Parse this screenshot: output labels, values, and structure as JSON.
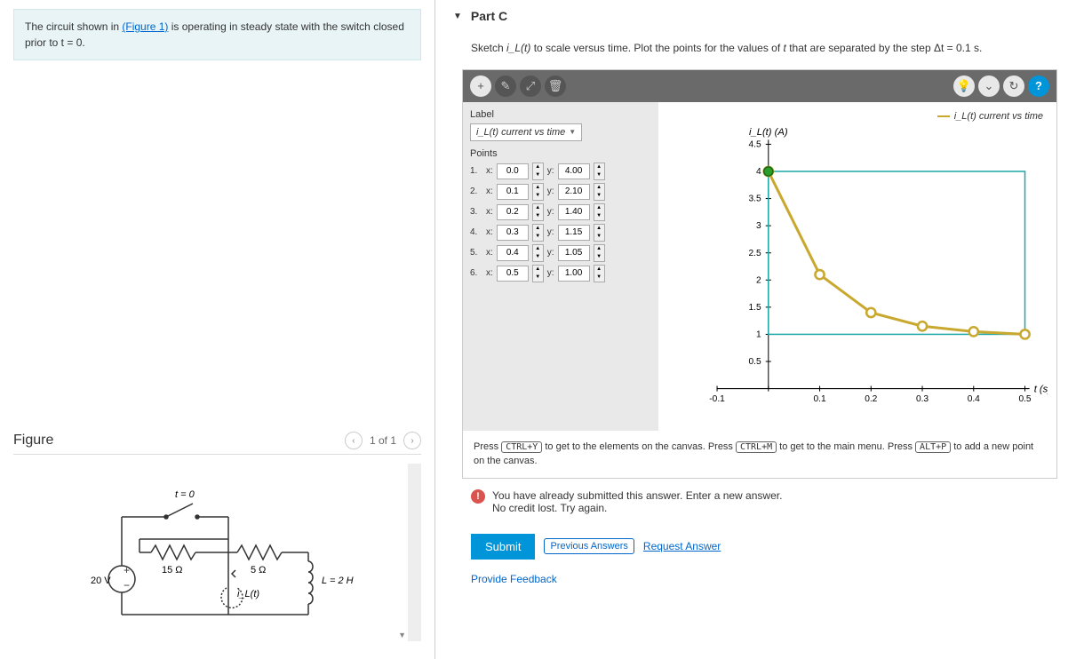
{
  "problem": {
    "text_before_link": "The circuit shown in ",
    "link_text": "(Figure 1)",
    "text_after_link": " is operating in steady state with the switch closed prior to t = 0."
  },
  "figure": {
    "title": "Figure",
    "pager": "1 of 1",
    "labels": {
      "t0": "t = 0",
      "voltage": "20 V",
      "r1": "15 Ω",
      "r2": "5 Ω",
      "current": "i_L(t)",
      "inductor": "L = 2 H"
    }
  },
  "part": {
    "title": "Part C",
    "instruction_prefix": "Sketch ",
    "instruction_var": "i_L(t)",
    "instruction_mid": " to scale versus time. Plot the points for the values of ",
    "instruction_var2": "t",
    "instruction_suffix": " that are separated by the step Δt = 0.1 s."
  },
  "editor": {
    "label_title": "Label",
    "label_value": "i_L(t) current vs time",
    "points_title": "Points",
    "points": [
      {
        "n": "1.",
        "x": "0.0",
        "y": "4.00"
      },
      {
        "n": "2.",
        "x": "0.1",
        "y": "2.10"
      },
      {
        "n": "3.",
        "x": "0.2",
        "y": "1.40"
      },
      {
        "n": "4.",
        "x": "0.3",
        "y": "1.15"
      },
      {
        "n": "5.",
        "x": "0.4",
        "y": "1.05"
      },
      {
        "n": "6.",
        "x": "0.5",
        "y": "1.00"
      }
    ],
    "legend": "i_L(t) current vs time",
    "hint_p1": "Press ",
    "hint_k1": "CTRL+Y",
    "hint_p2": " to get to the elements on the canvas. Press ",
    "hint_k2": "CTRL+M",
    "hint_p3": " to get to the main menu. Press ",
    "hint_k3": "ALT+P",
    "hint_p4": " to add a new point on the canvas."
  },
  "chart_data": {
    "type": "line",
    "title": "",
    "xlabel": "t (s)",
    "ylabel": "i_L(t) (A)",
    "x": [
      0.0,
      0.1,
      0.2,
      0.3,
      0.4,
      0.5
    ],
    "y": [
      4.0,
      2.1,
      1.4,
      1.15,
      1.05,
      1.0
    ],
    "xlim": [
      -0.1,
      0.5
    ],
    "ylim": [
      0,
      4.5
    ],
    "xticks": [
      -0.1,
      0,
      0.1,
      0.2,
      0.3,
      0.4,
      0.5
    ],
    "yticks": [
      0.5,
      1.0,
      1.5,
      2.0,
      2.5,
      3.0,
      3.5,
      4.0,
      4.5
    ],
    "series_name": "i_L(t) current vs time",
    "series_color": "#c9a82f"
  },
  "feedback": {
    "line1": "You have already submitted this answer. Enter a new answer.",
    "line2": "No credit lost. Try again."
  },
  "actions": {
    "submit": "Submit",
    "prev": "Previous Answers",
    "request": "Request Answer"
  },
  "footer": "Provide Feedback"
}
